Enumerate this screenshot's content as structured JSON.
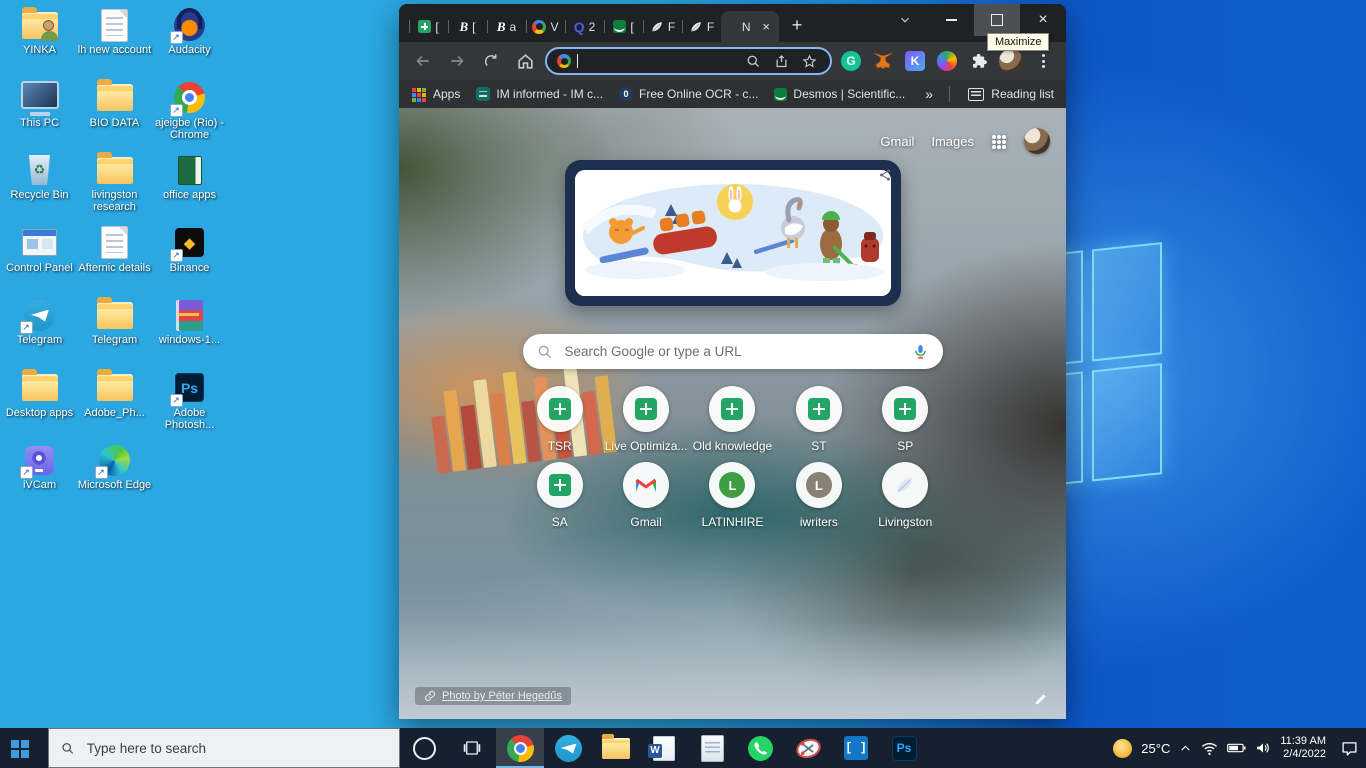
{
  "desktop": {
    "icons": [
      {
        "label": "YINKA",
        "icon": "folder_user",
        "shortcut": false
      },
      {
        "label": "lh new account",
        "icon": "doc",
        "shortcut": false
      },
      {
        "label": "Audacity",
        "icon": "audacity",
        "shortcut": true
      },
      {
        "label": "This PC",
        "icon": "pc",
        "shortcut": false
      },
      {
        "label": "BIO DATA",
        "icon": "folder",
        "shortcut": false
      },
      {
        "label": "ajeigbe (Rio) - Chrome",
        "icon": "chrome",
        "shortcut": true
      },
      {
        "label": "Recycle Bin",
        "icon": "recycle",
        "shortcut": false
      },
      {
        "label": "livingston research",
        "icon": "folder",
        "shortcut": false
      },
      {
        "label": "office apps",
        "icon": "office",
        "shortcut": false
      },
      {
        "label": "Control Panel",
        "icon": "control",
        "shortcut": false
      },
      {
        "label": "Afternic details",
        "icon": "doc",
        "shortcut": false
      },
      {
        "label": "Binance",
        "icon": "binance",
        "shortcut": true
      },
      {
        "label": "Telegram",
        "icon": "telegram",
        "shortcut": true
      },
      {
        "label": "Telegram",
        "icon": "folder",
        "shortcut": false
      },
      {
        "label": "windows-1...",
        "icon": "winrar",
        "shortcut": false
      },
      {
        "label": "Desktop apps",
        "icon": "folder",
        "shortcut": false
      },
      {
        "label": "Adobe_Ph...",
        "icon": "folder",
        "shortcut": false
      },
      {
        "label": "Adobe Photosh...",
        "icon": "ps",
        "shortcut": true
      },
      {
        "label": "iVCam",
        "icon": "ivcam",
        "shortcut": true
      },
      {
        "label": "Microsoft Edge",
        "icon": "edge",
        "shortcut": true
      }
    ]
  },
  "browser": {
    "tabs": [
      {
        "icon": "sheets",
        "title": "["
      },
      {
        "icon": "letter_b",
        "title": "["
      },
      {
        "icon": "letter_b",
        "title": "a"
      },
      {
        "icon": "google",
        "title": "V"
      },
      {
        "icon": "letter_q",
        "title": "2"
      },
      {
        "icon": "desmos",
        "title": "["
      },
      {
        "icon": "quill",
        "title": "F"
      },
      {
        "icon": "quill",
        "title": "F"
      },
      {
        "icon": "none",
        "title": "N",
        "active": true
      }
    ],
    "new_tab_button": "+",
    "window_controls": {
      "tooltip": "Maximize"
    },
    "omnibox": {
      "value": ""
    },
    "bookmarks": {
      "items": [
        {
          "icon": "apps_grid",
          "label": "Apps"
        },
        {
          "icon": "im",
          "label": "IM informed - IM c..."
        },
        {
          "icon": "ocr",
          "label": "Free Online OCR - c..."
        },
        {
          "icon": "desmos",
          "label": "Desmos | Scientific..."
        }
      ],
      "more": "»",
      "reading_list": "Reading list"
    },
    "ntp": {
      "header": {
        "gmail": "Gmail",
        "images": "Images"
      },
      "search_placeholder": "Search Google or type a URL",
      "shortcuts": [
        {
          "icon": "sheets_tile",
          "label": "TSR"
        },
        {
          "icon": "sheets_tile",
          "label": "Live Optimiza..."
        },
        {
          "icon": "sheets_tile",
          "label": "Old knowledge"
        },
        {
          "icon": "sheets_tile",
          "label": "ST"
        },
        {
          "icon": "sheets_tile",
          "label": "SP"
        },
        {
          "icon": "sheets_tile",
          "label": "SA"
        },
        {
          "icon": "gmail_tile",
          "label": "Gmail"
        },
        {
          "icon": "green_l_tile",
          "label": "LATINHIRE"
        },
        {
          "icon": "gray_l_tile",
          "label": "iwriters"
        },
        {
          "icon": "feather_tile",
          "label": "Livingston"
        }
      ],
      "attribution": "Photo by Péter Hegedűs"
    }
  },
  "taskbar": {
    "search_placeholder": "Type here to search",
    "apps": [
      {
        "icon": "chrome",
        "name": "chrome",
        "active": true
      },
      {
        "icon": "telegram",
        "name": "telegram"
      },
      {
        "icon": "explorer",
        "name": "file-explorer"
      },
      {
        "icon": "word",
        "name": "word"
      },
      {
        "icon": "notepad",
        "name": "notepad"
      },
      {
        "icon": "whatsapp",
        "name": "whatsapp"
      },
      {
        "icon": "snip",
        "name": "snipping-tool"
      },
      {
        "icon": "brackets",
        "name": "brackets-app"
      },
      {
        "icon": "ps",
        "name": "photoshop"
      }
    ],
    "tray": {
      "temperature": "25°C",
      "time": "11:39 AM",
      "date": "2/4/2022"
    }
  }
}
